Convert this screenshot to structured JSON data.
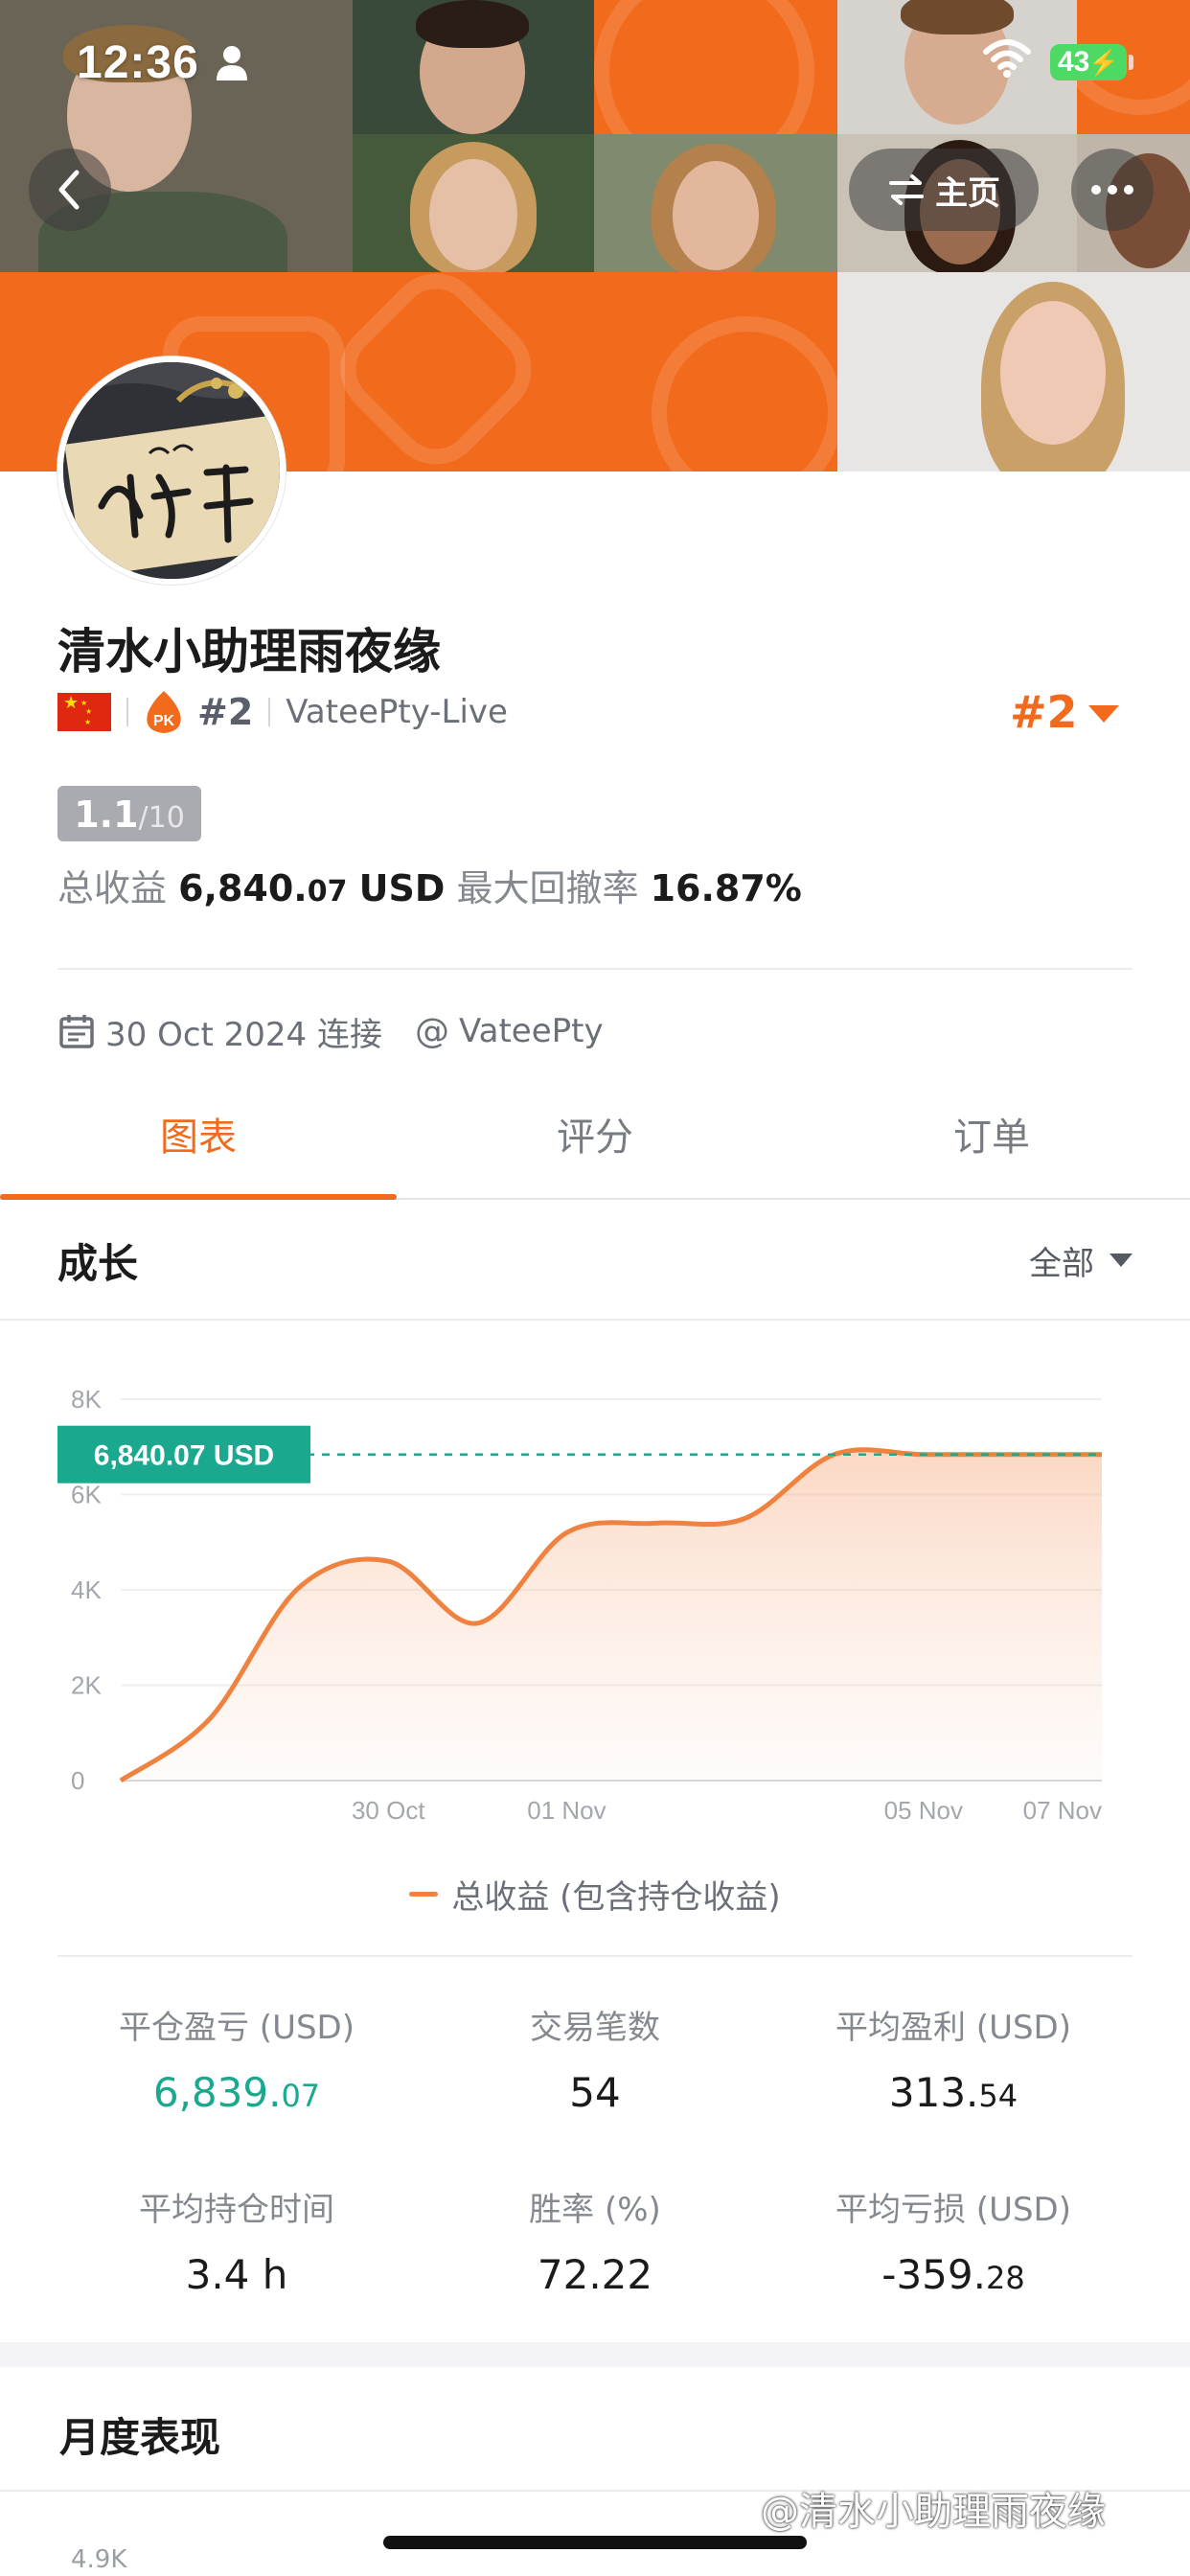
{
  "status_bar": {
    "time": "12:36",
    "battery": "43"
  },
  "header": {
    "home_label": "主页"
  },
  "profile": {
    "name": "清水小助理雨夜缘",
    "rank": "#2",
    "server": "VateePty-Live",
    "rank_right": "#2",
    "score": "1.1",
    "score_max": "/10",
    "total_label": "总收益",
    "total_value_main": "6,840.",
    "total_value_dec": "07",
    "total_unit": "USD",
    "drawdown_label": "最大回撤率",
    "drawdown_value": "16.87%",
    "connect_date": "30 Oct 2024 连接",
    "broker": "VateePty"
  },
  "tabs": [
    "图表",
    "评分",
    "订单"
  ],
  "growth": {
    "title": "成长",
    "filter": "全部"
  },
  "chart_data": {
    "type": "area",
    "series": [
      {
        "name": "总收益 (包含持仓收益)",
        "x": [
          "27 Oct",
          "28 Oct",
          "29 Oct",
          "30 Oct",
          "31 Oct",
          "01 Nov",
          "02 Nov",
          "03 Nov",
          "04 Nov",
          "05 Nov",
          "06 Nov",
          "07 Nov"
        ],
        "values": [
          0,
          1300,
          4050,
          4600,
          3300,
          5200,
          5400,
          5500,
          6840.07,
          6840.07,
          6840.07,
          6840.07
        ]
      }
    ],
    "y_ticks": [
      "0",
      "2K",
      "4K",
      "6K",
      "8K"
    ],
    "x_ticks": [
      "30 Oct",
      "01 Nov",
      "05 Nov",
      "07 Nov"
    ],
    "ylim": [
      0,
      8000
    ],
    "current_value_label": "6,840.07 USD",
    "current_value": 6840.07,
    "line_color": "#f0823f",
    "marker_color": "#1aa88f"
  },
  "stats": [
    {
      "label": "平仓盈亏 (USD)",
      "main": "6,839.",
      "dec": "07",
      "green": true
    },
    {
      "label": "交易笔数",
      "main": "54",
      "dec": ""
    },
    {
      "label": "平均盈利 (USD)",
      "main": "313.",
      "dec": "54"
    },
    {
      "label": "平均持仓时间",
      "main": "3.4 h",
      "dec": ""
    },
    {
      "label": "胜率 (%)",
      "main": "72.22",
      "dec": ""
    },
    {
      "label": "平均亏损 (USD)",
      "main": "-359.",
      "dec": "28"
    }
  ],
  "monthly": {
    "title": "月度表现",
    "axis_top": "4.9K"
  },
  "watermark": "@清水小助理雨夜缘",
  "colors": {
    "accent": "#f26a1b",
    "positive": "#1aa88f"
  }
}
